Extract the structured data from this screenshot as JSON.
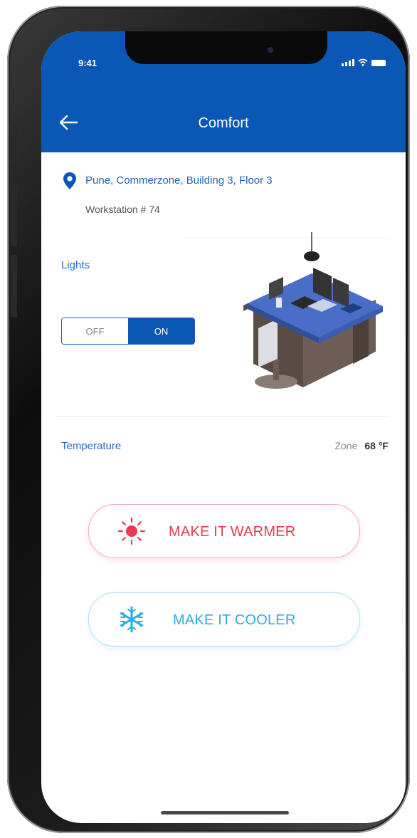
{
  "status_bar": {
    "time": "9:41"
  },
  "header": {
    "title": "Comfort",
    "bg_color": "#0b57b5"
  },
  "location": {
    "address": "Pune, Commerzone, Building 3, Floor 3",
    "workstation": "Workstation # 74"
  },
  "lights": {
    "label": "Lights",
    "toggle": {
      "off_label": "OFF",
      "on_label": "ON",
      "selected": "ON"
    }
  },
  "temperature": {
    "label": "Temperature",
    "zone_label": "Zone",
    "zone_value": "68 °F"
  },
  "actions": {
    "warmer_label": "MAKE IT WARMER",
    "cooler_label": "MAKE IT COOLER",
    "warm_color": "#e83b4b",
    "cool_color": "#29aee0"
  }
}
